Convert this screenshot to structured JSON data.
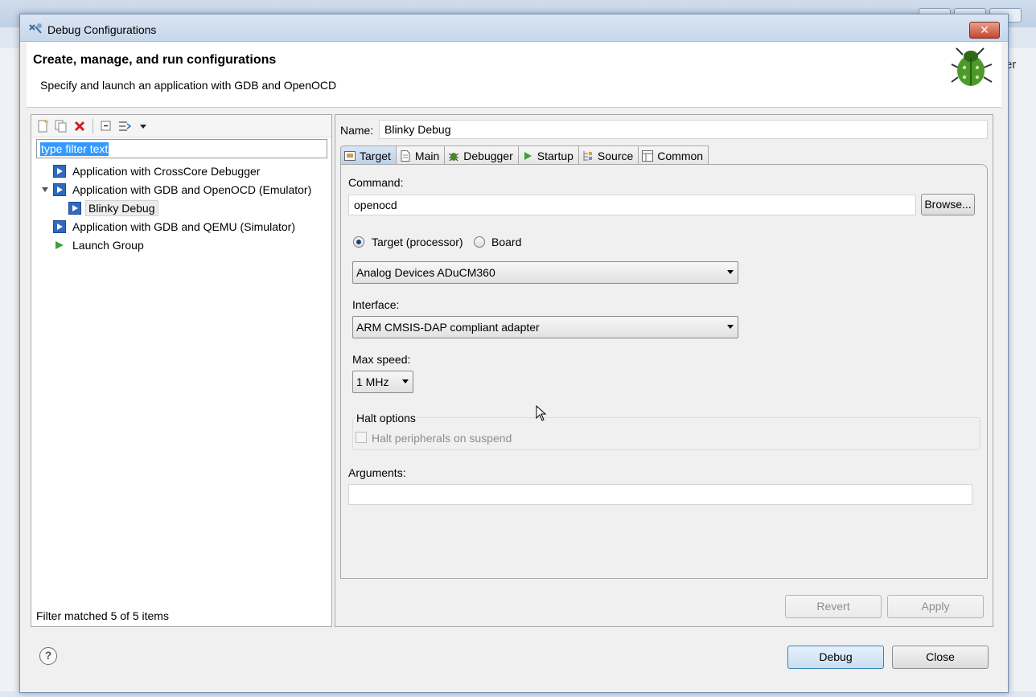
{
  "window": {
    "title": "Debug Configurations",
    "header_title": "Create, manage, and run configurations",
    "header_description": "Specify and launch an application with GDB and OpenOCD",
    "close_glyph": "✕"
  },
  "toolbar": {
    "icons": [
      "new-config-icon",
      "duplicate-icon",
      "delete-icon",
      "collapse-all-icon",
      "filter-icon",
      "view-menu-icon"
    ]
  },
  "filter": {
    "text": "type filter text",
    "status": "Filter matched 5 of 5 items"
  },
  "tree": {
    "items": [
      {
        "label": "Application with CrossCore Debugger"
      },
      {
        "label": "Application with GDB and OpenOCD (Emulator)"
      },
      {
        "label": "Blinky Debug"
      },
      {
        "label": "Application with GDB and QEMU (Simulator)"
      },
      {
        "label": "Launch Group"
      }
    ]
  },
  "config": {
    "name_label": "Name:",
    "name_value": "Blinky Debug",
    "tabs": [
      {
        "label": "Target",
        "icon": "target-tab-icon"
      },
      {
        "label": "Main",
        "icon": "main-tab-icon"
      },
      {
        "label": "Debugger",
        "icon": "debugger-tab-icon"
      },
      {
        "label": "Startup",
        "icon": "startup-tab-icon"
      },
      {
        "label": "Source",
        "icon": "source-tab-icon"
      },
      {
        "label": "Common",
        "icon": "common-tab-icon"
      }
    ]
  },
  "target": {
    "command_label": "Command:",
    "command_value": "openocd",
    "browse_label": "Browse...",
    "radio_processor": "Target (processor)",
    "radio_board": "Board",
    "processor_value": "Analog Devices ADuCM360",
    "interface_label": "Interface:",
    "interface_value": "ARM CMSIS-DAP compliant adapter",
    "maxspeed_label": "Max speed:",
    "maxspeed_value": "1 MHz",
    "halt_group_label": "Halt options",
    "halt_checkbox_label": "Halt peripherals on suspend",
    "arguments_label": "Arguments:",
    "arguments_value": ""
  },
  "buttons": {
    "revert": "Revert",
    "apply": "Apply",
    "debug": "Debug",
    "close": "Close",
    "help_glyph": "?"
  },
  "background": {
    "right_fragment": "er"
  },
  "colors": {
    "selection": "#3399ff",
    "close_red": "#c4452c",
    "title_gradient_top": "#dbe6f3",
    "active_tab": "#b9d0ea"
  }
}
